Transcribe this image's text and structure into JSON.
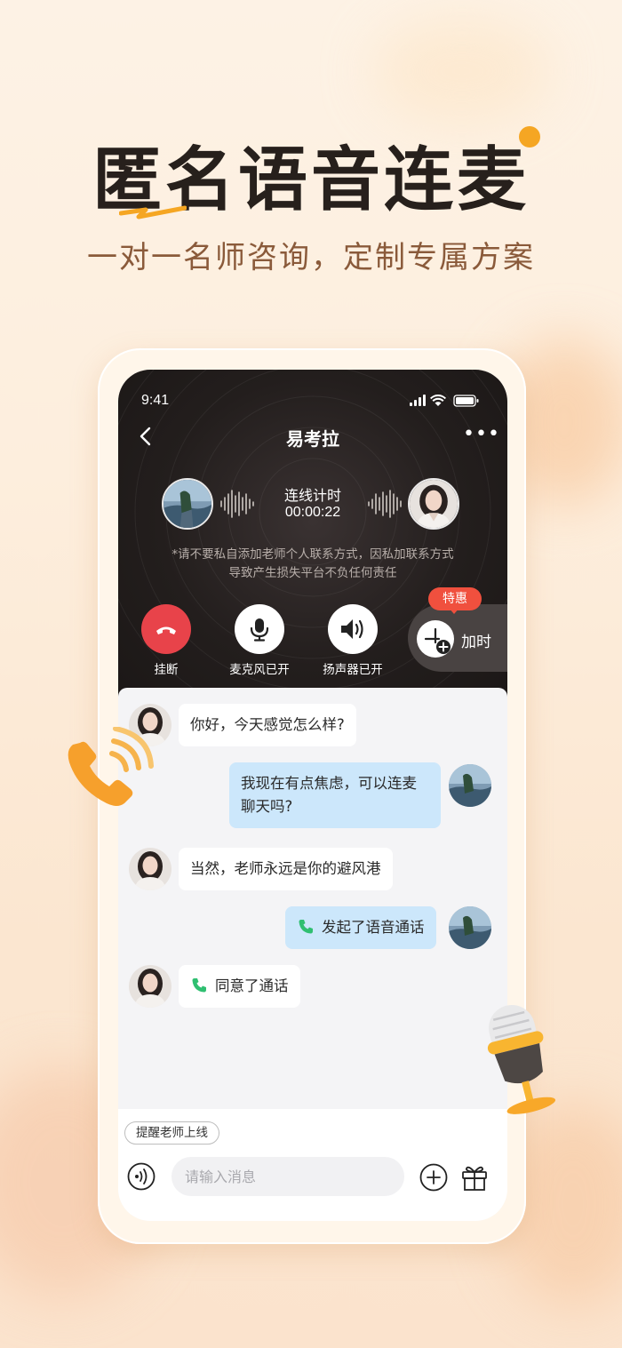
{
  "hero": {
    "title": "匿名语音连麦",
    "subtitle": "一对一名师咨询，定制专属方案"
  },
  "status_bar": {
    "time": "9:41"
  },
  "nav": {
    "title": "易考拉",
    "more": "•••"
  },
  "call": {
    "timer_label": "连线计时",
    "timer_value": "00:00:22",
    "disclaimer_line1": "*请不要私自添加老师个人联系方式，因私加联系方式",
    "disclaimer_line2": "导致产生损失平台不负任何责任",
    "controls": {
      "hangup": "挂断",
      "mic": "麦克风已开",
      "speaker": "扬声器已开",
      "extend": "加时",
      "promo": "特惠"
    }
  },
  "messages": [
    {
      "from": "teacher",
      "text": "你好，今天感觉怎么样?"
    },
    {
      "from": "me",
      "text_line1": "我现在有点焦虑，可以连麦",
      "text_line2": "聊天吗?"
    },
    {
      "from": "teacher",
      "text": "当然，老师永远是你的避风港"
    },
    {
      "from": "me",
      "text": "发起了语音通话",
      "icon": "phone-call-icon"
    },
    {
      "from": "teacher",
      "text": "同意了通话",
      "icon": "phone-call-icon"
    }
  ],
  "composer": {
    "remind_chip": "提醒老师上线",
    "placeholder": "请输入消息"
  },
  "colors": {
    "accent_orange": "#f5a623",
    "hangup_red": "#e8434a",
    "promo_red": "#f0503e",
    "call_green": "#2fbf71",
    "outgoing_bubble": "#cce7fb"
  }
}
